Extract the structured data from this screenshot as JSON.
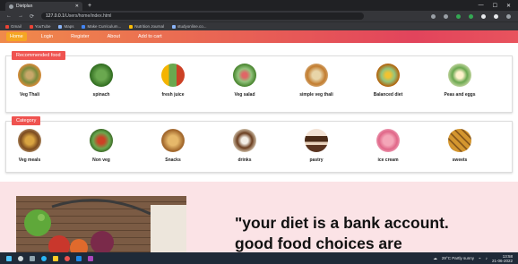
{
  "browser": {
    "tab_title": "Dietplan",
    "url_host": "127.0.0.1",
    "url_path": "/Users/home/index.html",
    "bookmarks": [
      {
        "label": "Gmail",
        "icon": "gmail-icon"
      },
      {
        "label": "YouTube",
        "icon": "youtube-icon"
      },
      {
        "label": "Maps",
        "icon": "maps-icon"
      },
      {
        "label": "Make Curriculum...",
        "icon": "bookmark-icon"
      },
      {
        "label": "Nutrition Journal",
        "icon": "bookmark-icon"
      },
      {
        "label": "studyonline.co...",
        "icon": "bookmark-icon"
      }
    ]
  },
  "nav": {
    "items": [
      "Home",
      "Login",
      "Register",
      "About",
      "Add to cart"
    ],
    "active": "Home"
  },
  "recommended": {
    "title": "Recommended food",
    "items": [
      "Veg Thali",
      "spinach",
      "fresh juice",
      "Veg salad",
      "simple veg thali",
      "Balanced diet",
      "Peas and eggs"
    ]
  },
  "category": {
    "title": "Category",
    "items": [
      "Veg meals",
      "Non veg",
      "Snacks",
      "drinks",
      "pastry",
      "ice cream",
      "sweets"
    ]
  },
  "hero": {
    "quote_line1": "\"your diet is a bank account.",
    "quote_line2": "good food choices are"
  },
  "taskbar": {
    "weather": "29°C  Partly sunny",
    "time": "13:58",
    "date": "21-06-2022"
  },
  "colors": {
    "nav_gradient_start": "#f08a4b",
    "nav_gradient_end": "#e2445c",
    "badge": "#ef5350",
    "hero_bg": "#fbe3e6"
  }
}
